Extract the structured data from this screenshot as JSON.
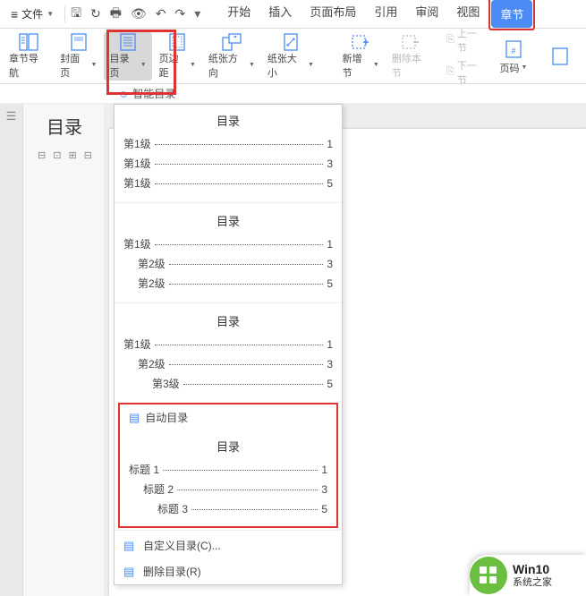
{
  "topbar": {
    "file_label": "文件",
    "tabs": [
      "开始",
      "插入",
      "页面布局",
      "引用",
      "审阅",
      "视图",
      "章节"
    ],
    "active_tab": "章节"
  },
  "ribbon": {
    "buttons": [
      {
        "label": "章节导航",
        "icon": "nav"
      },
      {
        "label": "封面页",
        "icon": "cover",
        "dropdown": true
      },
      {
        "label": "目录页",
        "icon": "toc",
        "dropdown": true,
        "selected": true
      },
      {
        "label": "页边距",
        "icon": "margin",
        "dropdown": true
      },
      {
        "label": "纸张方向",
        "icon": "orient",
        "dropdown": true
      },
      {
        "label": "纸张大小",
        "icon": "size",
        "dropdown": true
      },
      {
        "label": "新增节",
        "icon": "newsec",
        "dropdown": true
      },
      {
        "label": "删除本节",
        "icon": "delsec",
        "disabled": true
      },
      {
        "label": "页码",
        "icon": "pagenum",
        "dropdown": true
      }
    ],
    "prev_section": "上一节",
    "next_section": "下一节",
    "smart_toc": "智能目录"
  },
  "doc": {
    "heading": "目录"
  },
  "dropdown": {
    "toc_title": "目录",
    "samples": [
      {
        "lines": [
          {
            "lv": 1,
            "label": "第1级",
            "page": "1"
          },
          {
            "lv": 1,
            "label": "第1级",
            "page": "3"
          },
          {
            "lv": 1,
            "label": "第1级",
            "page": "5"
          }
        ]
      },
      {
        "lines": [
          {
            "lv": 1,
            "label": "第1级",
            "page": "1"
          },
          {
            "lv": 2,
            "label": "第2级",
            "page": "3"
          },
          {
            "lv": 2,
            "label": "第2级",
            "page": "5"
          }
        ]
      },
      {
        "lines": [
          {
            "lv": 1,
            "label": "第1级",
            "page": "1"
          },
          {
            "lv": 2,
            "label": "第2级",
            "page": "3"
          },
          {
            "lv": 3,
            "label": "第3级",
            "page": "5"
          }
        ]
      }
    ],
    "auto_toc_label": "自动目录",
    "auto_sample": {
      "lines": [
        {
          "lv": 1,
          "label": "标题 1",
          "page": "1"
        },
        {
          "lv": 2,
          "label": "标题 2",
          "page": "3"
        },
        {
          "lv": 3,
          "label": "标题 3",
          "page": "5"
        }
      ]
    },
    "custom_toc": "自定义目录(C)...",
    "delete_toc": "删除目录(R)"
  },
  "badge": {
    "line1": "Win10",
    "line2": "系统之家"
  }
}
